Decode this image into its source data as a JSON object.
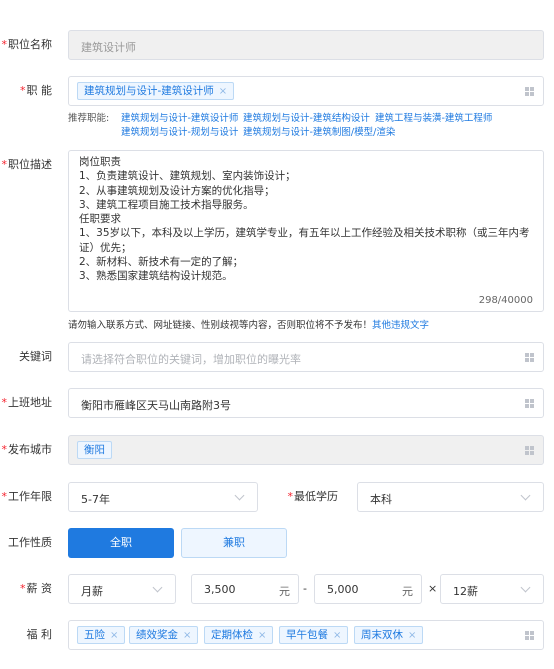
{
  "job_name": {
    "label": "职位名称",
    "value": "建筑设计师"
  },
  "job_function": {
    "label": "职 能",
    "tag": "建筑规划与设计-建筑设计师",
    "recommend_label": "推荐职能:",
    "recommend_line1": [
      "建筑规划与设计-建筑设计师",
      "建筑规划与设计-建筑结构设计",
      "建筑工程与装潢-建筑工程师"
    ],
    "recommend_line2": [
      "建筑规划与设计-规划与设计",
      "建筑规划与设计-建筑制图/模型/渲染"
    ]
  },
  "job_desc": {
    "label": "职位描述",
    "lines": [
      "岗位职责",
      "1、负责建筑设计、建筑规划、室内装饰设计；",
      "2、从事建筑规划及设计方案的优化指导；",
      "3、建筑工程项目施工技术指导服务。",
      "任职要求",
      "1、35岁以下，本科及以上学历，建筑学专业，有五年以上工作经验及相关技术职称（或三年内考",
      "证）优先；",
      "2、新材料、新技术有一定的了解；",
      "3、熟悉国家建筑结构设计规范。"
    ],
    "counter": "298/40000",
    "notice": "请勿输入联系方式、网址链接、性别歧视等内容，否则职位将不予发布！",
    "notice_link": "其他违规文字"
  },
  "keywords": {
    "label": "关键词",
    "placeholder": "请选择符合职位的关键词，增加职位的曝光率"
  },
  "address": {
    "label": "上班地址",
    "value": "衡阳市雁峰区天马山南路附3号"
  },
  "city": {
    "label": "发布城市",
    "tag": "衡阳"
  },
  "experience": {
    "label": "工作年限",
    "value": "5-7年"
  },
  "education": {
    "label": "最低学历",
    "value": "本科"
  },
  "job_type": {
    "label": "工作性质",
    "fulltime": "全职",
    "parttime": "兼职"
  },
  "salary": {
    "label": "薪 资",
    "type": "月薪",
    "min": "3,500",
    "max": "5,000",
    "unit": "元",
    "dash": "-",
    "times": "×",
    "months": "12薪"
  },
  "welfare": {
    "label": "福 利",
    "tags": [
      "五险",
      "绩效奖金",
      "定期体检",
      "早午包餐",
      "周末双休"
    ]
  },
  "colors": {
    "primary": "#1f7ae0",
    "required": "#f5222d"
  },
  "tag_close": "×"
}
